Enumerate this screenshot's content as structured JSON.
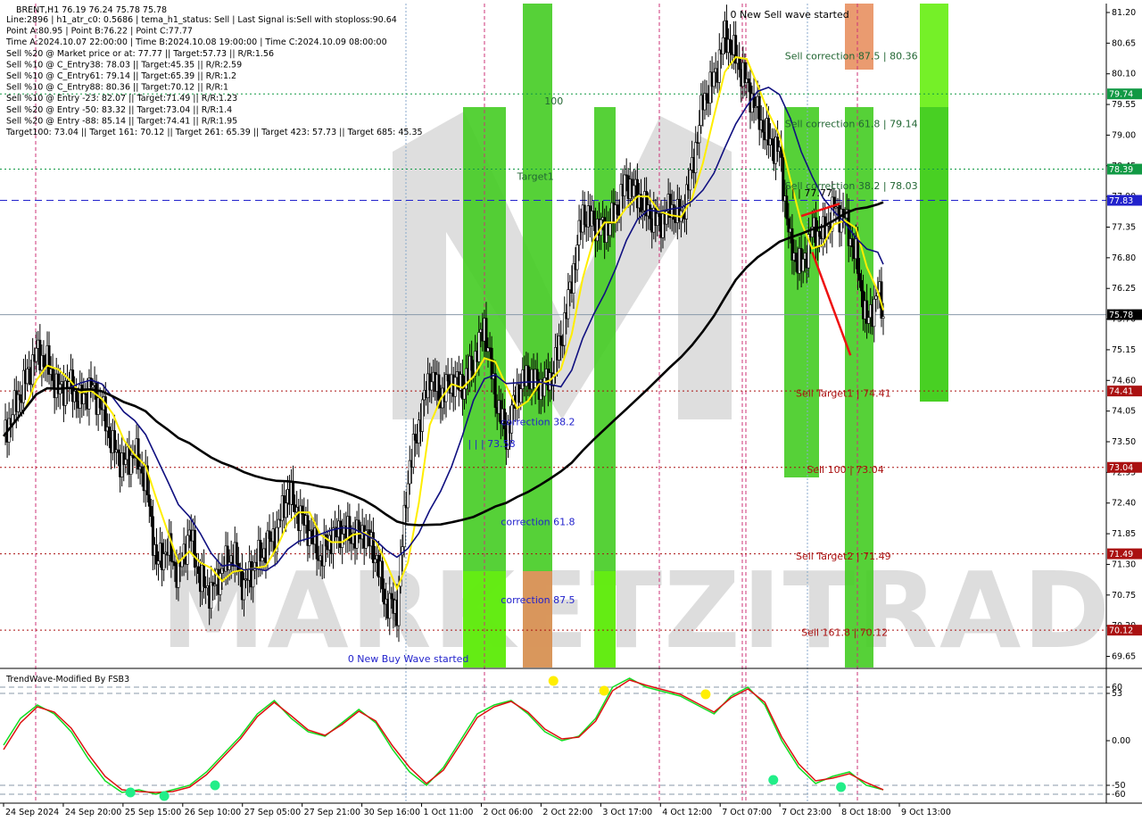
{
  "header": {
    "symbol_line": "BRENT,H1  76.19 76.24 75.78 75.78",
    "info_lines": [
      "Line:2896 | h1_atr_c0: 0.5686 | tema_h1_status: Sell | Last Signal is:Sell with stoploss:90.64",
      "Point A:80.95 | Point B:76.22 | Point C:77.77",
      "Time A:2024.10.07 22:00:00 | Time B:2024.10.08 19:00:00 | Time C:2024.10.09 08:00:00",
      "Sell %20 @ Market price or at: 77.77 || Target:57.73 || R/R:1.56",
      "Sell %10 @ C_Entry38: 78.03 || Target:45.35 || R/R:2.59",
      "Sell %10 @ C_Entry61: 79.14 || Target:65.39 || R/R:1.2",
      "Sell %10 @ C_Entry88: 80.36 || Target:70.12 || R/R:1",
      "Sell %10 @ Entry -23: 82.07 || Target:71.49 || R/R:1.23",
      "Sell %20 @ Entry -50: 83.32 || Target:73.04 || R/R:1.4",
      "Sell %20 @ Entry -88: 85.14 || Target:74.41 || R/R:1.95",
      "Target100: 73.04 || Target 161: 70.12 || Target 261: 65.39 || Target 423: 57.73 || Target 685: 45.35"
    ]
  },
  "indicator": {
    "title": "TrendWave-Modified By FSB3"
  },
  "colors": {
    "bull_green": "#66ee11",
    "mid_green": "#44cc22",
    "orange": "#e89060",
    "ma_navy": "#101080",
    "ma_black": "#000000",
    "tema_yellow": "#ffee00",
    "level_red": "#aa1111",
    "level_green": "#11aa66",
    "level_blue": "#2222cc",
    "osc_green": "#11dd22",
    "osc_red": "#dd1111"
  },
  "chart_data": [
    {
      "type": "candlestick",
      "title": "BRENT,H1",
      "ylim": [
        69.45,
        81.36
      ],
      "yticks": [
        69.65,
        70.2,
        70.75,
        71.3,
        71.85,
        72.4,
        72.95,
        73.5,
        74.05,
        74.6,
        75.15,
        75.7,
        76.25,
        76.8,
        77.35,
        77.9,
        78.45,
        79.0,
        79.55,
        80.1,
        80.65,
        81.2
      ],
      "xtick_labels": [
        "24 Sep 2024",
        "24 Sep 20:00",
        "25 Sep 15:00",
        "26 Sep 10:00",
        "27 Sep 05:00",
        "27 Sep 21:00",
        "30 Sep 16:00",
        "1 Oct 11:00",
        "2 Oct 06:00",
        "2 Oct 22:00",
        "3 Oct 17:00",
        "4 Oct 12:00",
        "7 Oct 07:00",
        "7 Oct 23:00",
        "8 Oct 18:00",
        "9 Oct 13:00"
      ],
      "last_price": 75.78,
      "close_path": [
        {
          "x": 0,
          "y": 73.6
        },
        {
          "x": 2,
          "y": 74.1
        },
        {
          "x": 4,
          "y": 74.6
        },
        {
          "x": 6,
          "y": 75.1
        },
        {
          "x": 8,
          "y": 74.9
        },
        {
          "x": 10,
          "y": 74.4
        },
        {
          "x": 12,
          "y": 74.55
        },
        {
          "x": 14,
          "y": 74.2
        },
        {
          "x": 16,
          "y": 74.5
        },
        {
          "x": 18,
          "y": 74.1
        },
        {
          "x": 20,
          "y": 73.4
        },
        {
          "x": 22,
          "y": 73.1
        },
        {
          "x": 24,
          "y": 73.3
        },
        {
          "x": 26,
          "y": 72.8
        },
        {
          "x": 28,
          "y": 71.3
        },
        {
          "x": 30,
          "y": 71.6
        },
        {
          "x": 32,
          "y": 71.1
        },
        {
          "x": 34,
          "y": 71.9
        },
        {
          "x": 36,
          "y": 71.0
        },
        {
          "x": 38,
          "y": 70.8
        },
        {
          "x": 40,
          "y": 71.2
        },
        {
          "x": 42,
          "y": 71.5
        },
        {
          "x": 44,
          "y": 70.9
        },
        {
          "x": 46,
          "y": 71.3
        },
        {
          "x": 48,
          "y": 71.6
        },
        {
          "x": 50,
          "y": 71.9
        },
        {
          "x": 52,
          "y": 72.6
        },
        {
          "x": 54,
          "y": 72.2
        },
        {
          "x": 56,
          "y": 71.9
        },
        {
          "x": 58,
          "y": 71.4
        },
        {
          "x": 60,
          "y": 71.8
        },
        {
          "x": 62,
          "y": 71.9
        },
        {
          "x": 64,
          "y": 71.8
        },
        {
          "x": 66,
          "y": 71.9
        },
        {
          "x": 68,
          "y": 71.5
        },
        {
          "x": 70,
          "y": 70.6
        },
        {
          "x": 72,
          "y": 70.5
        },
        {
          "x": 74,
          "y": 72.9
        },
        {
          "x": 76,
          "y": 73.8
        },
        {
          "x": 78,
          "y": 74.7
        },
        {
          "x": 80,
          "y": 74.3
        },
        {
          "x": 82,
          "y": 74.6
        },
        {
          "x": 84,
          "y": 74.5
        },
        {
          "x": 86,
          "y": 74.9
        },
        {
          "x": 88,
          "y": 75.6
        },
        {
          "x": 90,
          "y": 74.3
        },
        {
          "x": 92,
          "y": 73.6
        },
        {
          "x": 94,
          "y": 74.4
        },
        {
          "x": 96,
          "y": 74.7
        },
        {
          "x": 98,
          "y": 74.5
        },
        {
          "x": 100,
          "y": 74.6
        },
        {
          "x": 102,
          "y": 75.3
        },
        {
          "x": 104,
          "y": 76.4
        },
        {
          "x": 106,
          "y": 77.6
        },
        {
          "x": 108,
          "y": 77.4
        },
        {
          "x": 110,
          "y": 77.3
        },
        {
          "x": 112,
          "y": 77.6
        },
        {
          "x": 114,
          "y": 78.2
        },
        {
          "x": 116,
          "y": 77.9
        },
        {
          "x": 118,
          "y": 77.6
        },
        {
          "x": 120,
          "y": 77.4
        },
        {
          "x": 122,
          "y": 77.7
        },
        {
          "x": 124,
          "y": 77.5
        },
        {
          "x": 126,
          "y": 78.4
        },
        {
          "x": 128,
          "y": 79.6
        },
        {
          "x": 130,
          "y": 80.0
        },
        {
          "x": 132,
          "y": 80.8
        },
        {
          "x": 134,
          "y": 80.4
        },
        {
          "x": 136,
          "y": 79.9
        },
        {
          "x": 138,
          "y": 79.4
        },
        {
          "x": 140,
          "y": 78.9
        },
        {
          "x": 142,
          "y": 78.7
        },
        {
          "x": 144,
          "y": 77.0
        },
        {
          "x": 146,
          "y": 76.6
        },
        {
          "x": 148,
          "y": 77.3
        },
        {
          "x": 150,
          "y": 77.2
        },
        {
          "x": 152,
          "y": 77.7
        },
        {
          "x": 154,
          "y": 77.5
        },
        {
          "x": 156,
          "y": 76.8
        },
        {
          "x": 158,
          "y": 75.6
        },
        {
          "x": 160,
          "y": 76.2
        },
        {
          "x": 161,
          "y": 75.78
        }
      ],
      "levels": [
        {
          "label": "79.74",
          "value": 79.74,
          "style": "green-dotted"
        },
        {
          "label": "78.39",
          "value": 78.39,
          "style": "green-dotted"
        },
        {
          "label": "77.83",
          "value": 77.83,
          "style": "blue-dashed"
        },
        {
          "label": "75.78",
          "value": 75.78,
          "style": "gray-solid"
        },
        {
          "label": "74.41",
          "value": 74.41,
          "style": "red-dotted"
        },
        {
          "label": "73.04",
          "value": 73.04,
          "style": "red-dotted"
        },
        {
          "label": "71.49",
          "value": 71.49,
          "style": "red-dotted"
        },
        {
          "label": "70.12",
          "value": 70.12,
          "style": "red-dotted"
        }
      ],
      "annotations": [
        {
          "text": "0 New Sell wave started",
          "x": 133,
          "y": 81.1,
          "color": "#000000"
        },
        {
          "text": "Sell correction 87.5 | 80.36",
          "x": 143,
          "y": 80.36,
          "color": "#226633"
        },
        {
          "text": "Sell correction 61.8 | 79.14",
          "x": 143,
          "y": 79.14,
          "color": "#226633"
        },
        {
          "text": "Sell correction 38.2 | 78.03",
          "x": 143,
          "y": 78.03,
          "color": "#226633"
        },
        {
          "text": "| | | 77.77",
          "x": 143,
          "y": 77.9,
          "color": "#000000"
        },
        {
          "text": "Sell Target1 | 74.41",
          "x": 145,
          "y": 74.31,
          "color": "#aa1111"
        },
        {
          "text": "Sell 100 | 73.04",
          "x": 147,
          "y": 72.94,
          "color": "#aa1111"
        },
        {
          "text": "Sell Target2 | 71.49",
          "x": 145,
          "y": 71.39,
          "color": "#aa1111"
        },
        {
          "text": "Sell 161.8 | 70.12",
          "x": 146,
          "y": 70.02,
          "color": "#aa1111"
        },
        {
          "text": "100",
          "x": 99,
          "y": 79.55,
          "color": "#226633"
        },
        {
          "text": "Target1",
          "x": 94,
          "y": 78.2,
          "color": "#226633"
        },
        {
          "text": "correction 38.2",
          "x": 91,
          "y": 73.8,
          "color": "#2222cc"
        },
        {
          "text": "| | | 73.58",
          "x": 85,
          "y": 73.4,
          "color": "#2222cc"
        },
        {
          "text": "correction 61.8",
          "x": 91,
          "y": 72.0,
          "color": "#2222cc"
        },
        {
          "text": "correction 87.5",
          "x": 91,
          "y": 70.6,
          "color": "#2222cc"
        },
        {
          "text": "0 New Buy Wave started",
          "x": 63,
          "y": 69.55,
          "color": "#2222cc"
        }
      ]
    },
    {
      "type": "line",
      "title": "TrendWave-Modified By FSB3",
      "ylim": [
        -70,
        78
      ],
      "yticks": [
        60,
        53,
        0.0,
        -50,
        -60
      ],
      "ytick_labels": [
        "60",
        "53",
        "0.00",
        "-50",
        "-60"
      ],
      "series": [
        {
          "values": [
            -5,
            25,
            40,
            30,
            10,
            -20,
            -45,
            -58,
            -55,
            -60,
            -55,
            -50,
            -35,
            -15,
            5,
            30,
            45,
            25,
            10,
            5,
            20,
            35,
            20,
            -10,
            -35,
            -50,
            -30,
            0,
            30,
            40,
            45,
            30,
            10,
            0,
            5,
            25,
            60,
            70,
            60,
            55,
            50,
            40,
            30,
            50,
            60,
            40,
            0,
            -30,
            -48,
            -40,
            -35,
            -50,
            -55
          ]
        },
        {
          "values": [
            -10,
            20,
            38,
            32,
            14,
            -15,
            -40,
            -55,
            -57,
            -58,
            -57,
            -52,
            -38,
            -18,
            2,
            27,
            43,
            28,
            12,
            6,
            18,
            33,
            22,
            -6,
            -30,
            -48,
            -33,
            -4,
            26,
            38,
            44,
            32,
            13,
            2,
            4,
            22,
            56,
            68,
            62,
            57,
            52,
            42,
            32,
            48,
            58,
            43,
            4,
            -26,
            -45,
            -42,
            -37,
            -47,
            -55
          ]
        }
      ],
      "markers": [
        {
          "x": 7.5,
          "y": -58,
          "color": "cyan"
        },
        {
          "x": 9.5,
          "y": -62,
          "color": "cyan"
        },
        {
          "x": 12.5,
          "y": -50,
          "color": "cyan"
        },
        {
          "x": 32.5,
          "y": 67,
          "color": "yellow"
        },
        {
          "x": 35.5,
          "y": 56,
          "color": "yellow"
        },
        {
          "x": 41.5,
          "y": 52,
          "color": "yellow"
        },
        {
          "x": 45.5,
          "y": -44,
          "color": "cyan"
        },
        {
          "x": 49.5,
          "y": -52,
          "color": "cyan"
        }
      ]
    }
  ]
}
